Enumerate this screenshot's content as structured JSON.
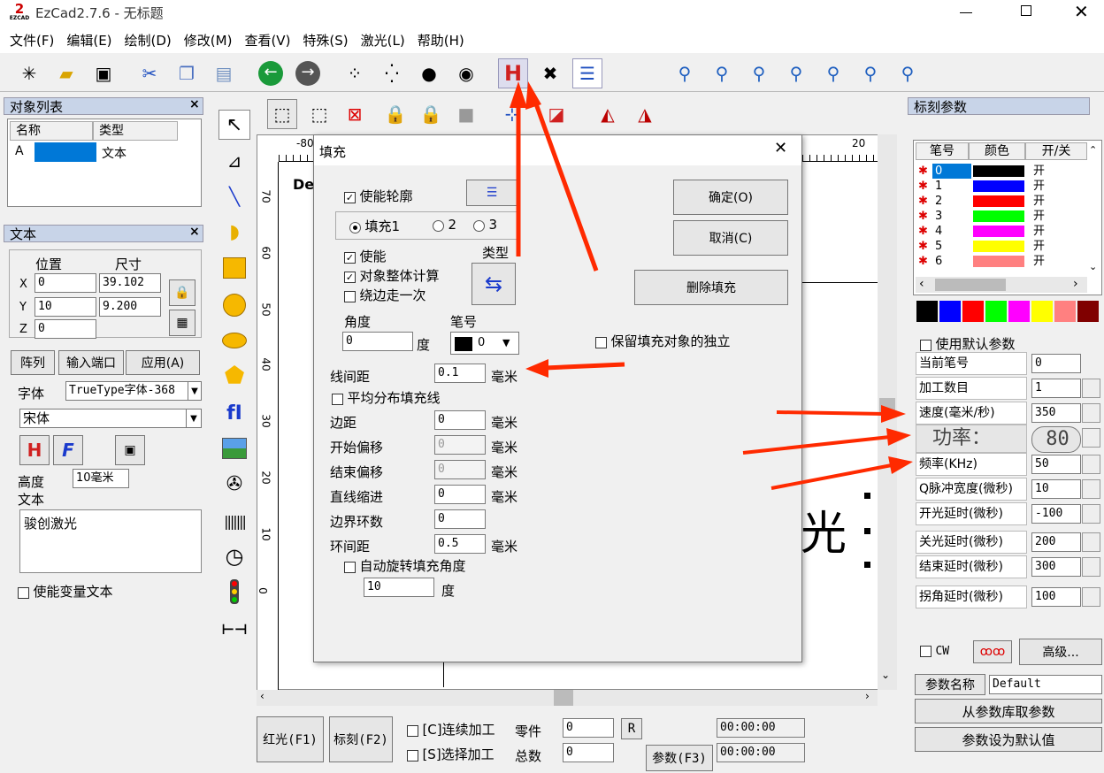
{
  "window": {
    "title": "EzCad2.7.6 - 无标题",
    "logo": "EZCAD"
  },
  "menu": [
    "文件(F)",
    "编辑(E)",
    "绘制(D)",
    "修改(M)",
    "查看(V)",
    "特殊(S)",
    "激光(L)",
    "帮助(H)"
  ],
  "object_list": {
    "title": "对象列表",
    "col_name": "名称",
    "col_type": "类型",
    "row_id": "A",
    "row_type": "文本"
  },
  "text_panel": {
    "title": "文本",
    "pos_label": "位置",
    "size_label": "尺寸",
    "x_label": "X",
    "y_label": "Y",
    "z_label": "Z",
    "x": "0",
    "y": "10",
    "z": "0",
    "w": "39.102",
    "h": "9.200",
    "array_btn": "阵列",
    "input_port_btn": "输入端口",
    "apply_btn": "应用(A)",
    "font_label": "字体",
    "font_type": "TrueType字体-368",
    "font_name": "宋体",
    "height_label": "高度",
    "height_value": "10毫米",
    "text_label": "文本",
    "text_value": "骏创激光",
    "variable_text": "使能变量文本"
  },
  "canvas": {
    "ruler_left": "-80",
    "ruler_right": "20",
    "text_partial": "De",
    "big_text": "光",
    "ruler_v": [
      "70",
      "60",
      "50",
      "40",
      "30",
      "20",
      "10",
      "0"
    ]
  },
  "fill_dialog": {
    "title": "填充",
    "ok": "确定(O)",
    "cancel": "取消(C)",
    "delete": "删除填充",
    "enable_outline": "使能轮廓",
    "fill1": "填充1",
    "fill2": "2",
    "fill3": "3",
    "enable": "使能",
    "whole_calc": "对象整体计算",
    "edge_once": "绕边走一次",
    "type_label": "类型",
    "angle_label": "角度",
    "angle_value": "0",
    "deg": "度",
    "pen_label": "笔号",
    "pen_value": "0",
    "keep_independent": "保留填充对象的独立",
    "line_spacing_label": "线间距",
    "line_spacing": "0.1",
    "mm": "毫米",
    "even_distribute": "平均分布填充线",
    "margin_label": "边距",
    "margin": "0",
    "start_offset_label": "开始偏移",
    "start_offset": "0",
    "end_offset_label": "结束偏移",
    "end_offset": "0",
    "line_indent_label": "直线缩进",
    "line_indent": "0",
    "loop_count_label": "边界环数",
    "loop_count": "0",
    "loop_spacing_label": "环间距",
    "loop_spacing": "0.5",
    "auto_rotate": "自动旋转填充角度",
    "rotate_value": "10",
    "rotate_unit": "度"
  },
  "mark_params": {
    "title": "标刻参数",
    "col_pen": "笔号",
    "col_color": "颜色",
    "col_onoff": "开/关",
    "pens": [
      {
        "no": "0",
        "color": "#000000",
        "state": "开"
      },
      {
        "no": "1",
        "color": "#0000ff",
        "state": "开"
      },
      {
        "no": "2",
        "color": "#ff0000",
        "state": "开"
      },
      {
        "no": "3",
        "color": "#00ff00",
        "state": "开"
      },
      {
        "no": "4",
        "color": "#ff00ff",
        "state": "开"
      },
      {
        "no": "5",
        "color": "#ffff00",
        "state": "开"
      },
      {
        "no": "6",
        "color": "#ff8080",
        "state": "开"
      }
    ],
    "palette": [
      "#000000",
      "#0000ff",
      "#ff0000",
      "#00ff00",
      "#ff00ff",
      "#ffff00",
      "#ff8080",
      "#800000"
    ],
    "use_default": "使用默认参数",
    "rows": [
      {
        "label": "当前笔号",
        "value": "0"
      },
      {
        "label": "加工数目",
        "value": "1"
      },
      {
        "label": "速度(毫米/秒)",
        "value": "350"
      },
      {
        "label": "功率：",
        "value": "80"
      },
      {
        "label": "频率(KHz)",
        "value": "50"
      },
      {
        "label": "Q脉冲宽度(微秒)",
        "value": "10"
      },
      {
        "label": "开光延时(微秒)",
        "value": "-100"
      },
      {
        "label": "关光延时(微秒)",
        "value": "200"
      },
      {
        "label": "结束延时(微秒)",
        "value": "300"
      },
      {
        "label": "拐角延时(微秒)",
        "value": "100"
      }
    ],
    "cw": "CW",
    "advanced": "高级...",
    "param_name_label": "参数名称",
    "param_name": "Default",
    "load_from_lib": "从参数库取参数",
    "set_default": "参数设为默认值"
  },
  "bottom": {
    "red_light": "红光(F1)",
    "mark": "标刻(F2)",
    "continuous": "[C]连续加工",
    "select_process": "[S]选择加工",
    "part_label": "零件",
    "total_label": "总数",
    "part": "0",
    "total": "0",
    "r_btn": "R",
    "param_btn": "参数(F3)",
    "time1": "00:00:00",
    "time2": "00:00:00"
  }
}
